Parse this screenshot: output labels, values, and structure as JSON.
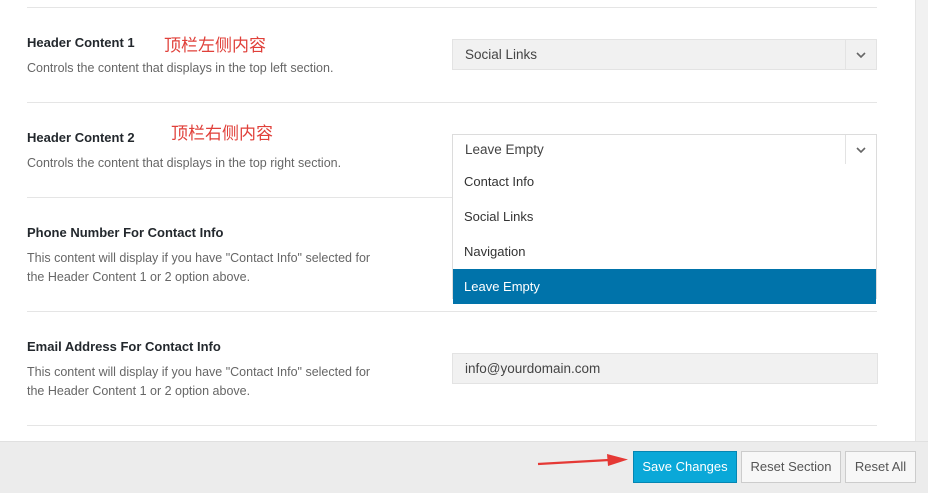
{
  "fields": {
    "header1": {
      "title": "Header Content 1",
      "desc": "Controls the content that displays in the top left section.",
      "annotation": "顶栏左侧内容",
      "value": "Social Links"
    },
    "header2": {
      "title": "Header Content 2",
      "desc": "Controls the content that displays in the top right section.",
      "annotation": "顶栏右侧内容",
      "value": "Leave Empty",
      "options": [
        "Contact Info",
        "Social Links",
        "Navigation",
        "Leave Empty"
      ],
      "selected_option": "Leave Empty"
    },
    "phone": {
      "title": "Phone Number For Contact Info",
      "desc_line1": "This content will display if you have \"Contact Info\" selected for",
      "desc_line2": "the Header Content 1 or 2 option above."
    },
    "email": {
      "title": "Email Address For Contact Info",
      "desc_line1": "This content will display if you have \"Contact Info\" selected for",
      "desc_line2": "the Header Content 1 or 2 option above.",
      "value": "info@yourdomain.com"
    }
  },
  "footer": {
    "save": "Save Changes",
    "reset_section": "Reset Section",
    "reset_all": "Reset All"
  },
  "colors": {
    "accent": "#0073aa",
    "primary_button": "#0aa8d8",
    "annotation": "#e0403a"
  },
  "icons": {
    "select_arrow": "chevron-down-icon",
    "annotation_arrow": "red-arrow-icon"
  }
}
